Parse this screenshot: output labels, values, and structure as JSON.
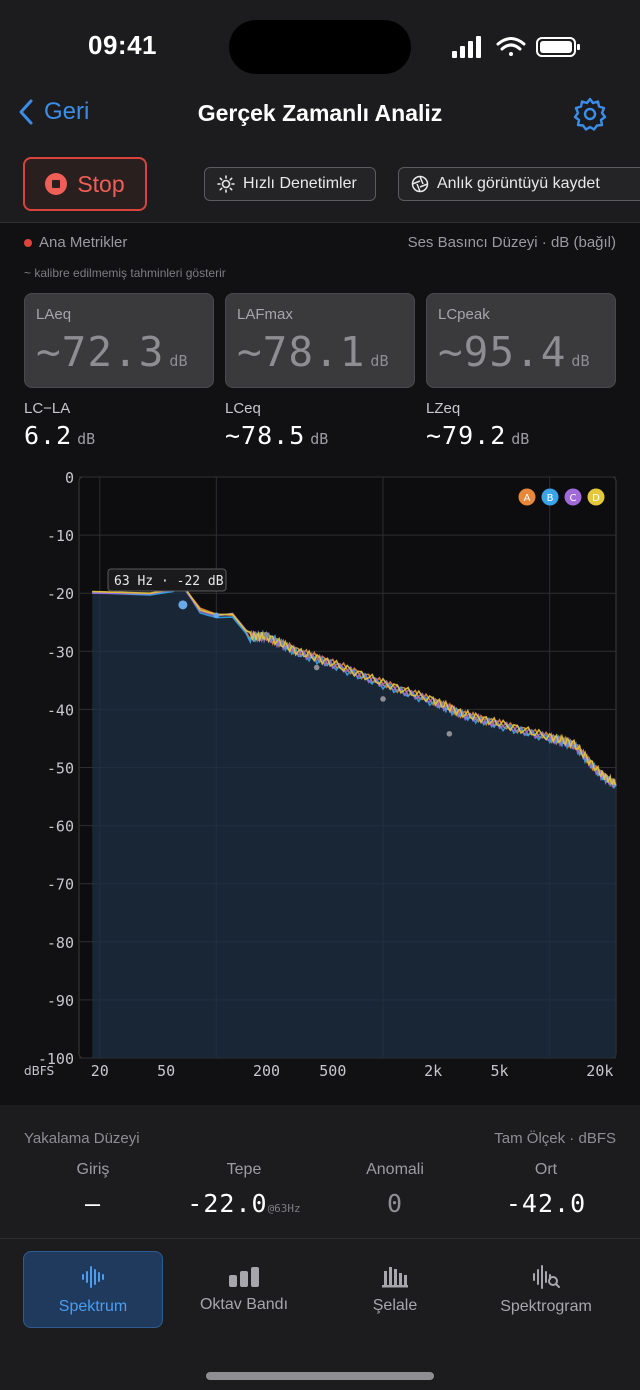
{
  "status_bar": {
    "time": "09:41"
  },
  "nav": {
    "back_label": "Geri",
    "title": "Gerçek Zamanlı Analiz"
  },
  "controls": {
    "stop_label": "Stop",
    "quick_label": "Hızlı Denetimler",
    "snapshot_label": "Anlık görüntüyü kaydet"
  },
  "metrics": {
    "section_title": "Ana Metrikler",
    "measure_label": "Ses Basıncı Düzeyi · dB (bağıl)",
    "caption": "~ kalibre edilmemiş tahminleri gösterir",
    "cards": [
      {
        "label": "LAeq",
        "value": "~72.3",
        "unit": "dB"
      },
      {
        "label": "LAFmax",
        "value": "~78.1",
        "unit": "dB"
      },
      {
        "label": "LCpeak",
        "value": "~95.4",
        "unit": "dB"
      }
    ],
    "secondary": [
      {
        "label": "LC−LA",
        "value": "6.2",
        "unit": "dB"
      },
      {
        "label": "LCeq",
        "value": "~78.5",
        "unit": "dB"
      },
      {
        "label": "LZeq",
        "value": "~79.2",
        "unit": "dB"
      }
    ]
  },
  "chart_data": {
    "type": "line",
    "x_scale": "log",
    "xlim": [
      15,
      25000
    ],
    "ylim": [
      -100,
      0
    ],
    "ylabel": "dBFS",
    "y_ticks": [
      0,
      -10,
      -20,
      -30,
      -40,
      -50,
      -60,
      -70,
      -80,
      -90,
      -100
    ],
    "x_ticks": [
      {
        "value": 20,
        "label": "20"
      },
      {
        "value": 50,
        "label": "50"
      },
      {
        "value": 200,
        "label": "200"
      },
      {
        "value": 500,
        "label": "500"
      },
      {
        "value": 2000,
        "label": "2k"
      },
      {
        "value": 5000,
        "label": "5k"
      },
      {
        "value": 20000,
        "label": "20k"
      }
    ],
    "vgrid": [
      20,
      100,
      1000,
      10000
    ],
    "legend": [
      "A",
      "B",
      "C",
      "D"
    ],
    "legend_position": "top-right",
    "tooltip": "63 Hz · -22 dB",
    "series": [
      {
        "name": "A",
        "color": "#e8883a",
        "x": [
          18,
          40,
          55,
          63,
          80,
          100,
          125,
          160,
          200,
          300,
          500,
          1000,
          2000,
          3000,
          5000,
          10000,
          14000,
          20000,
          25000
        ],
        "y": [
          -19.8,
          -20.2,
          -19.5,
          -18.8,
          -22.6,
          -23.6,
          -23.8,
          -27.5,
          -27.5,
          -29.8,
          -32,
          -35.5,
          -38.5,
          -40.8,
          -42.5,
          -44.8,
          -46,
          -51,
          -53
        ]
      },
      {
        "name": "B",
        "color": "#3aa4e8",
        "x": [
          18,
          40,
          55,
          63,
          80,
          100,
          125,
          160,
          200,
          300,
          500,
          1000,
          2000,
          3000,
          5000,
          10000,
          14000,
          20000,
          25000
        ],
        "y": [
          -19.9,
          -20.3,
          -19.7,
          -18.5,
          -23.4,
          -24.2,
          -24.1,
          -27.8,
          -27.2,
          -30.2,
          -32.4,
          -35.8,
          -38.8,
          -41,
          -42.8,
          -45,
          -46.2,
          -51.2,
          -53.2
        ]
      },
      {
        "name": "C",
        "color": "#a06ad8",
        "x": [
          18,
          40,
          55,
          63,
          80,
          100,
          125,
          160,
          200,
          300,
          500,
          1000,
          2000,
          3000,
          5000,
          10000,
          14000,
          20000,
          25000
        ],
        "y": [
          -20,
          -20.1,
          -19.4,
          -18.9,
          -23.1,
          -23.9,
          -23.5,
          -27.2,
          -27.6,
          -30,
          -32.2,
          -35.6,
          -38.6,
          -40.9,
          -42.6,
          -44.9,
          -46.1,
          -51.1,
          -53.1
        ]
      },
      {
        "name": "D",
        "color": "#e3c83a",
        "x": [
          18,
          40,
          55,
          63,
          80,
          100,
          125,
          160,
          200,
          300,
          500,
          1000,
          2000,
          3000,
          5000,
          10000,
          14000,
          20000,
          25000
        ],
        "y": [
          -19.7,
          -20,
          -19.3,
          -18.6,
          -22.9,
          -23.7,
          -23.6,
          -27.4,
          -27.4,
          -29.9,
          -32.1,
          -35.4,
          -38.4,
          -40.7,
          -42.4,
          -44.7,
          -45.9,
          -50.9,
          -52.9
        ]
      }
    ],
    "peaks": [
      {
        "x": 63,
        "y": -22
      },
      {
        "x": 100,
        "y": -23.8
      },
      {
        "x": 200,
        "y": -27.2
      },
      {
        "x": 400,
        "y": -32.8
      },
      {
        "x": 1000,
        "y": -38.2
      },
      {
        "x": 2500,
        "y": -44.2
      }
    ]
  },
  "capture": {
    "title": "Yakalama Düzeyi",
    "scale": "Tam Ölçek · dBFS",
    "columns": [
      {
        "label": "Giriş",
        "value": "—",
        "suffix": ""
      },
      {
        "label": "Tepe",
        "value": "-22.0",
        "suffix": "@63Hz"
      },
      {
        "label": "Anomali",
        "value": "0",
        "suffix": ""
      },
      {
        "label": "Ort",
        "value": "-42.0",
        "suffix": ""
      }
    ]
  },
  "tabs": [
    {
      "label": "Spektrum",
      "icon": "waveform-icon",
      "active": true
    },
    {
      "label": "Oktav Bandı",
      "icon": "bars-icon",
      "active": false
    },
    {
      "label": "Şelale",
      "icon": "waterfall-icon",
      "active": false
    },
    {
      "label": "Spektrogram",
      "icon": "spectrogram-search-icon",
      "active": false
    }
  ],
  "colors": {
    "accent": "#3a8eea",
    "stop": "#ef5f58",
    "active_tab": "#4b9df2"
  }
}
